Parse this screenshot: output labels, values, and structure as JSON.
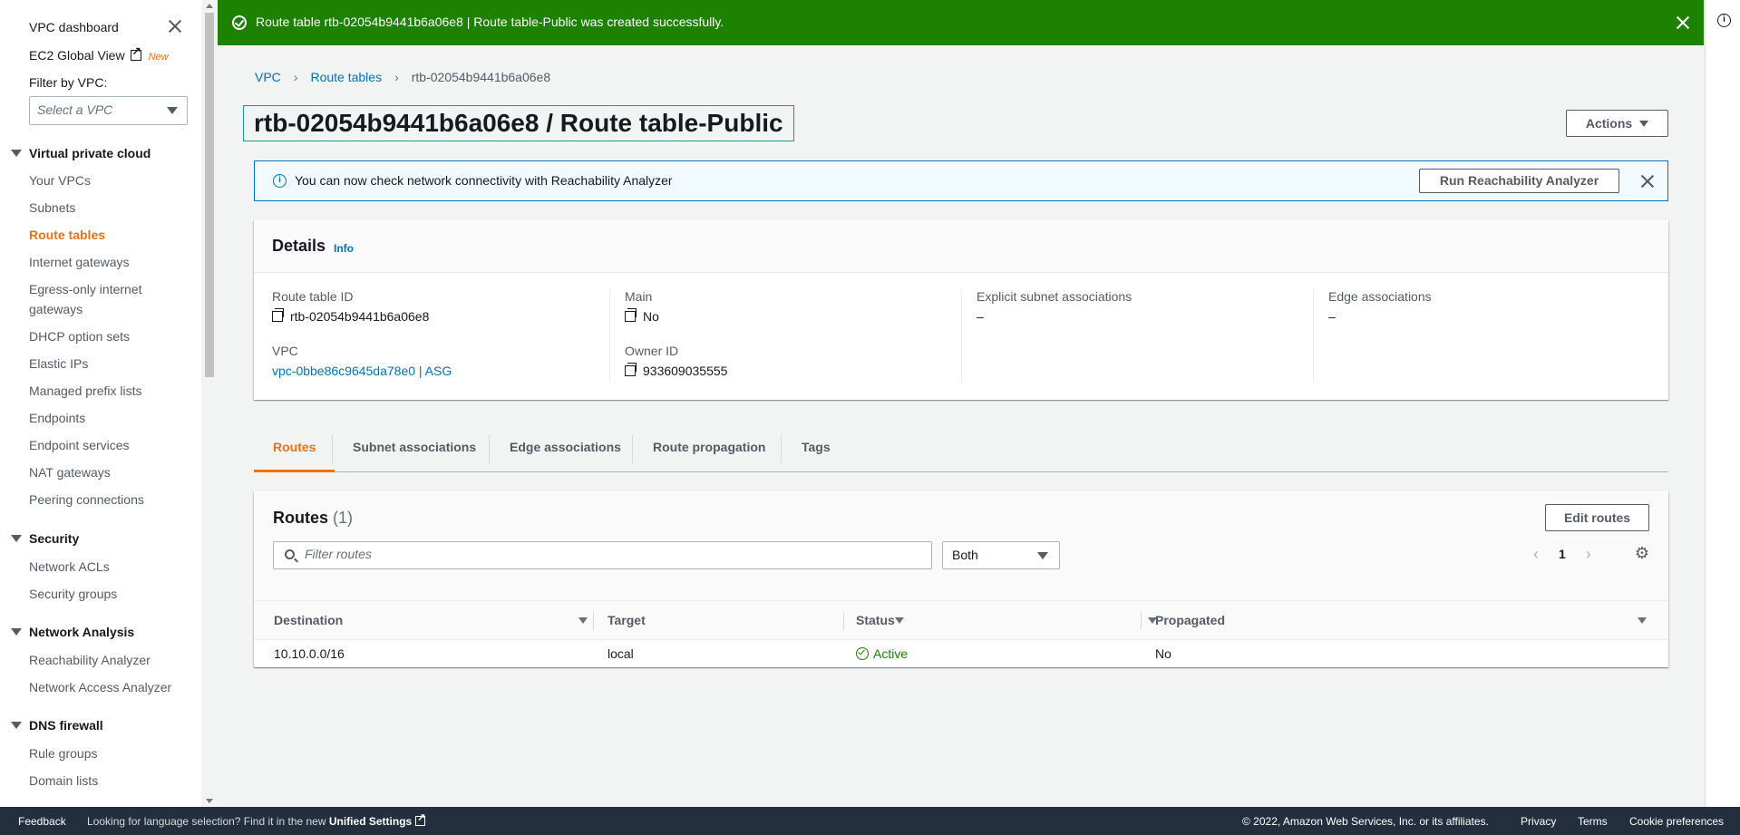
{
  "sidebar": {
    "dashboard": "VPC dashboard",
    "ec2_global_view": "EC2 Global View",
    "new_badge": "New",
    "filter_label": "Filter by VPC:",
    "vpc_select_placeholder": "Select a VPC",
    "sections": [
      {
        "title": "Virtual private cloud",
        "items": [
          "Your VPCs",
          "Subnets",
          "Route tables",
          "Internet gateways",
          "Egress-only internet",
          "gateways",
          "DHCP option sets",
          "Elastic IPs",
          "Managed prefix lists",
          "Endpoints",
          "Endpoint services",
          "NAT gateways",
          "Peering connections"
        ]
      },
      {
        "title": "Security",
        "items": [
          "Network ACLs",
          "Security groups"
        ]
      },
      {
        "title": "Network Analysis",
        "items": [
          "Reachability Analyzer",
          "Network Access Analyzer"
        ]
      },
      {
        "title": "DNS firewall",
        "items": [
          "Rule groups",
          "Domain lists"
        ]
      }
    ],
    "active_item": "Route tables"
  },
  "flash": {
    "message": "Route table rtb-02054b9441b6a06e8 | Route table-Public was created successfully.",
    "color": "#1d8102"
  },
  "breadcrumb": [
    "VPC",
    "Route tables",
    "rtb-02054b9441b6a06e8"
  ],
  "page_title": "rtb-02054b9441b6a06e8 / Route table-Public",
  "actions_label": "Actions",
  "info_alert": {
    "text": "You can now check network connectivity with Reachability Analyzer",
    "button": "Run Reachability Analyzer"
  },
  "details": {
    "title": "Details",
    "info_link": "Info",
    "route_table_id_label": "Route table ID",
    "route_table_id": "rtb-02054b9441b6a06e8",
    "main_label": "Main",
    "main": "No",
    "explicit_label": "Explicit subnet associations",
    "explicit": "–",
    "edge_label": "Edge associations",
    "edge": "–",
    "vpc_label": "VPC",
    "vpc": "vpc-0bbe86c9645da78e0 | ASG",
    "owner_label": "Owner ID",
    "owner": "933609035555"
  },
  "tabs": [
    "Routes",
    "Subnet associations",
    "Edge associations",
    "Route propagation",
    "Tags"
  ],
  "routes": {
    "title": "Routes",
    "count": "(1)",
    "edit_button": "Edit routes",
    "filter_placeholder": "Filter routes",
    "filter_select": "Both",
    "page": "1",
    "columns": [
      "Destination",
      "Target",
      "Status",
      "Propagated"
    ],
    "rows": [
      {
        "destination": "10.10.0.0/16",
        "target": "local",
        "status": "Active",
        "propagated": "No"
      }
    ]
  },
  "footer": {
    "feedback": "Feedback",
    "language_text": "Looking for language selection? Find it in the new",
    "unified_settings": "Unified Settings",
    "copyright": "© 2022, Amazon Web Services, Inc. or its affiliates.",
    "privacy": "Privacy",
    "terms": "Terms",
    "cookies": "Cookie preferences"
  },
  "colors": {
    "accent": "#ec7211",
    "link": "#0073bb",
    "success": "#1d8102",
    "footer_bg": "#232f3e"
  }
}
